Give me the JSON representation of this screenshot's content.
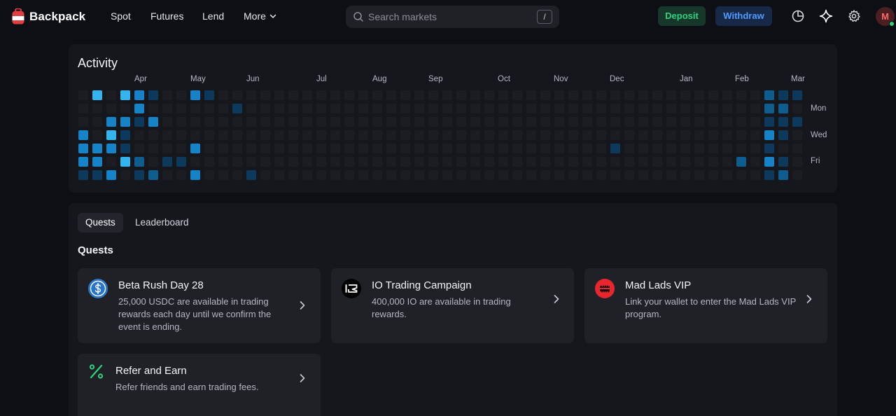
{
  "brand": {
    "name": "Backpack"
  },
  "nav": {
    "spot": "Spot",
    "futures": "Futures",
    "lend": "Lend",
    "more": "More"
  },
  "search": {
    "placeholder": "Search markets",
    "shortcut": "/"
  },
  "actions": {
    "deposit": "Deposit",
    "withdraw": "Withdraw"
  },
  "user": {
    "avatar_letter": "M"
  },
  "activity": {
    "title": "Activity",
    "months": [
      "Apr",
      "May",
      "Jun",
      "Jul",
      "Aug",
      "Sep",
      "Oct",
      "Nov",
      "Dec",
      "Jan",
      "Feb",
      "Mar"
    ],
    "day_labels": [
      "Mon",
      "Wed",
      "Fri"
    ],
    "num_weeks": 52,
    "levels": [
      {
        "week": 1,
        "day": 0,
        "level": 4
      },
      {
        "week": 1,
        "day": 4,
        "level": 3
      },
      {
        "week": 1,
        "day": 5,
        "level": 3
      },
      {
        "week": 1,
        "day": 6,
        "level": 1
      },
      {
        "week": 0,
        "day": 3,
        "level": 3
      },
      {
        "week": 0,
        "day": 4,
        "level": 3
      },
      {
        "week": 0,
        "day": 5,
        "level": 3
      },
      {
        "week": 0,
        "day": 6,
        "level": 1
      },
      {
        "week": 2,
        "day": 2,
        "level": 3
      },
      {
        "week": 2,
        "day": 3,
        "level": 4
      },
      {
        "week": 2,
        "day": 4,
        "level": 3
      },
      {
        "week": 2,
        "day": 6,
        "level": 3
      },
      {
        "week": 3,
        "day": 0,
        "level": 4
      },
      {
        "week": 3,
        "day": 2,
        "level": 3
      },
      {
        "week": 3,
        "day": 3,
        "level": 1
      },
      {
        "week": 3,
        "day": 4,
        "level": 1
      },
      {
        "week": 3,
        "day": 5,
        "level": 4
      },
      {
        "week": 4,
        "day": 0,
        "level": 3
      },
      {
        "week": 4,
        "day": 1,
        "level": 3
      },
      {
        "week": 4,
        "day": 2,
        "level": 1
      },
      {
        "week": 4,
        "day": 5,
        "level": 2
      },
      {
        "week": 4,
        "day": 6,
        "level": 1
      },
      {
        "week": 5,
        "day": 0,
        "level": 1
      },
      {
        "week": 5,
        "day": 2,
        "level": 3
      },
      {
        "week": 5,
        "day": 6,
        "level": 2
      },
      {
        "week": 6,
        "day": 5,
        "level": 1
      },
      {
        "week": 7,
        "day": 5,
        "level": 1
      },
      {
        "week": 8,
        "day": 0,
        "level": 3
      },
      {
        "week": 8,
        "day": 4,
        "level": 3
      },
      {
        "week": 8,
        "day": 6,
        "level": 3
      },
      {
        "week": 9,
        "day": 0,
        "level": 1
      },
      {
        "week": 11,
        "day": 1,
        "level": 1
      },
      {
        "week": 12,
        "day": 6,
        "level": 1
      },
      {
        "week": 38,
        "day": 4,
        "level": 1
      },
      {
        "week": 47,
        "day": 5,
        "level": 2
      },
      {
        "week": 49,
        "day": 0,
        "level": 2
      },
      {
        "week": 49,
        "day": 1,
        "level": 2
      },
      {
        "week": 49,
        "day": 2,
        "level": 1
      },
      {
        "week": 49,
        "day": 3,
        "level": 3
      },
      {
        "week": 49,
        "day": 4,
        "level": 1
      },
      {
        "week": 49,
        "day": 5,
        "level": 3
      },
      {
        "week": 49,
        "day": 6,
        "level": 1
      },
      {
        "week": 50,
        "day": 0,
        "level": 1
      },
      {
        "week": 50,
        "day": 1,
        "level": 2
      },
      {
        "week": 50,
        "day": 2,
        "level": 1
      },
      {
        "week": 50,
        "day": 3,
        "level": 1
      },
      {
        "week": 50,
        "day": 5,
        "level": 1
      },
      {
        "week": 50,
        "day": 6,
        "level": 2
      },
      {
        "week": 51,
        "day": 0,
        "level": 1
      },
      {
        "week": 51,
        "day": 2,
        "level": 1
      }
    ],
    "palette": {
      "0": "#1c1d23",
      "1": "#0d3a5c",
      "2": "#0f5c8f",
      "3": "#1683c9",
      "4": "#33b4ec"
    }
  },
  "quests": {
    "tabs": {
      "quests": "Quests",
      "leaderboard": "Leaderboard"
    },
    "section_title": "Quests",
    "cards": [
      {
        "title": "Beta Rush Day 28",
        "desc": "25,000 USDC are available in trading rewards each day until we confirm the event is ending.",
        "icon": "usdc-icon"
      },
      {
        "title": "IO Trading Campaign",
        "desc": "400,000 IO are available in trading rewards.",
        "icon": "io-icon"
      },
      {
        "title": "Mad Lads VIP",
        "desc": "Link your wallet to enter the Mad Lads VIP program.",
        "icon": "mad-lads-icon"
      },
      {
        "title": "Refer and Earn",
        "desc": "Refer friends and earn trading fees.",
        "icon": "percent-icon"
      }
    ]
  },
  "colors": {
    "accent_green": "#2ed37e",
    "accent_blue": "#4f9bff",
    "background": "#0e0f14",
    "panel": "#16171c",
    "card": "#202127"
  }
}
